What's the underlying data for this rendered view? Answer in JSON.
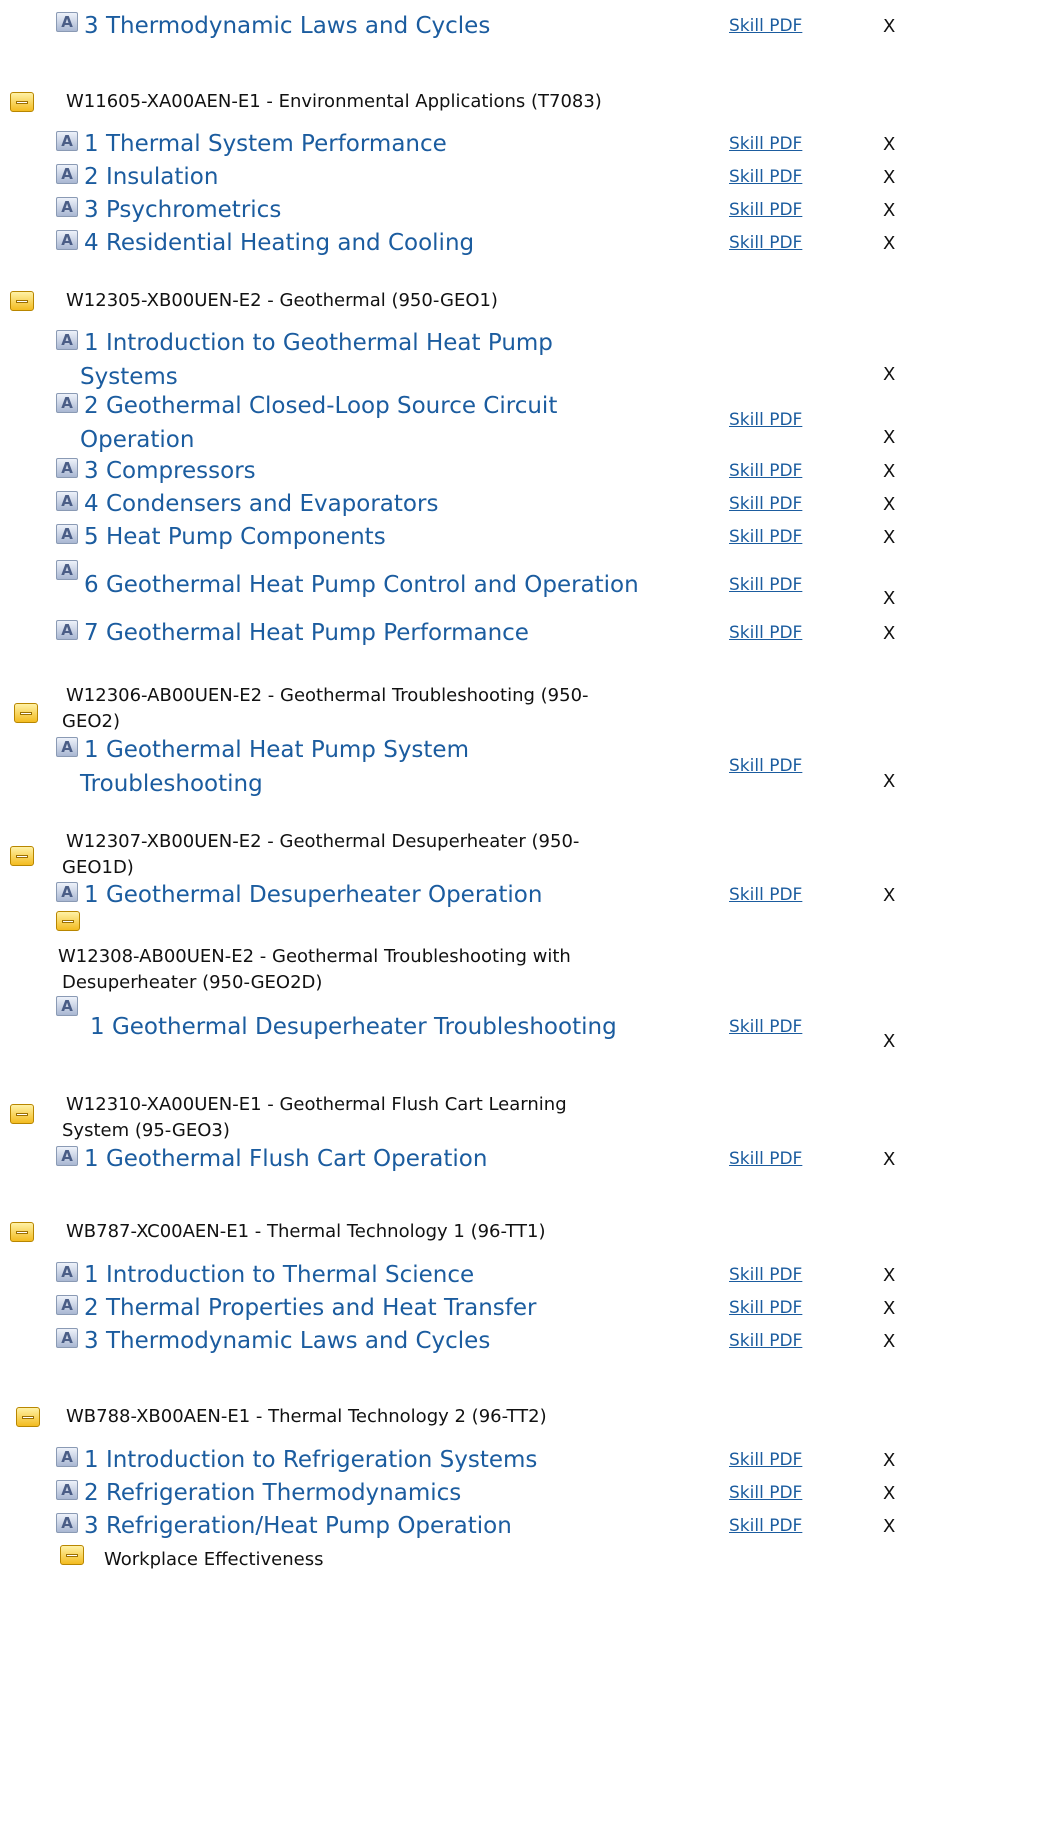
{
  "icons": {
    "collapse": "collapse-minus-icon",
    "activity": "activity-a-icon"
  },
  "colors": {
    "link": "#1b5c9f",
    "toggle": "#f3bb20"
  },
  "skill_label": "Skill PDF",
  "x_label": "X",
  "sections": {
    "s0": {
      "courses": [
        {
          "title": "3 Thermodynamic Laws and Cycles"
        }
      ]
    },
    "s1": {
      "heading": "W11605-XA00AEN-E1 - Environmental Applications (T7083)",
      "courses": [
        {
          "title": "1 Thermal System Performance"
        },
        {
          "title": "2 Insulation"
        },
        {
          "title": "3 Psychrometrics"
        },
        {
          "title": "4 Residential Heating and Cooling"
        }
      ]
    },
    "s2": {
      "heading": "W12305-XB00UEN-E2 - Geothermal (950-GEO1)",
      "courses": [
        {
          "title_l1": "1 Introduction to Geothermal Heat Pump",
          "title_l2": "Systems"
        },
        {
          "title_l1": "2 Geothermal Closed-Loop Source Circuit",
          "title_l2": "Operation"
        },
        {
          "title": "3 Compressors"
        },
        {
          "title": "4 Condensers and Evaporators"
        },
        {
          "title": "5 Heat Pump Components"
        },
        {
          "title": "6 Geothermal Heat Pump Control and Operation"
        },
        {
          "title": "7 Geothermal Heat Pump Performance"
        }
      ]
    },
    "s3": {
      "heading_l1": "W12306-AB00UEN-E2 - Geothermal Troubleshooting (950-",
      "heading_l2": "GEO2)",
      "courses": [
        {
          "title_l1": "1 Geothermal Heat Pump System",
          "title_l2": "Troubleshooting"
        }
      ]
    },
    "s4": {
      "heading_l1": "W12307-XB00UEN-E2 - Geothermal Desuperheater (950-",
      "heading_l2": "GEO1D)",
      "courses": [
        {
          "title": "1 Geothermal Desuperheater Operation"
        }
      ]
    },
    "s5": {
      "heading_l1": "W12308-AB00UEN-E2 - Geothermal Troubleshooting with",
      "heading_l2": "Desuperheater (950-GEO2D)",
      "courses": [
        {
          "title": "1 Geothermal Desuperheater Troubleshooting"
        }
      ]
    },
    "s6": {
      "heading_l1": "W12310-XA00UEN-E1 - Geothermal Flush Cart Learning",
      "heading_l2": "System (95-GEO3)",
      "courses": [
        {
          "title": "1 Geothermal Flush Cart Operation"
        }
      ]
    },
    "s7": {
      "heading": "WB787-XC00AEN-E1 - Thermal Technology 1 (96-TT1)",
      "courses": [
        {
          "title": "1 Introduction to Thermal Science"
        },
        {
          "title": "2 Thermal Properties and Heat Transfer"
        },
        {
          "title": "3 Thermodynamic Laws and Cycles"
        }
      ]
    },
    "s8": {
      "heading": "WB788-XB00AEN-E1 - Thermal Technology 2 (96-TT2)",
      "courses": [
        {
          "title": "1 Introduction to Refrigeration Systems"
        },
        {
          "title": "2 Refrigeration Thermodynamics"
        },
        {
          "title": "3 Refrigeration/Heat Pump Operation"
        }
      ]
    },
    "s9": {
      "heading": "Workplace Effectiveness"
    }
  }
}
